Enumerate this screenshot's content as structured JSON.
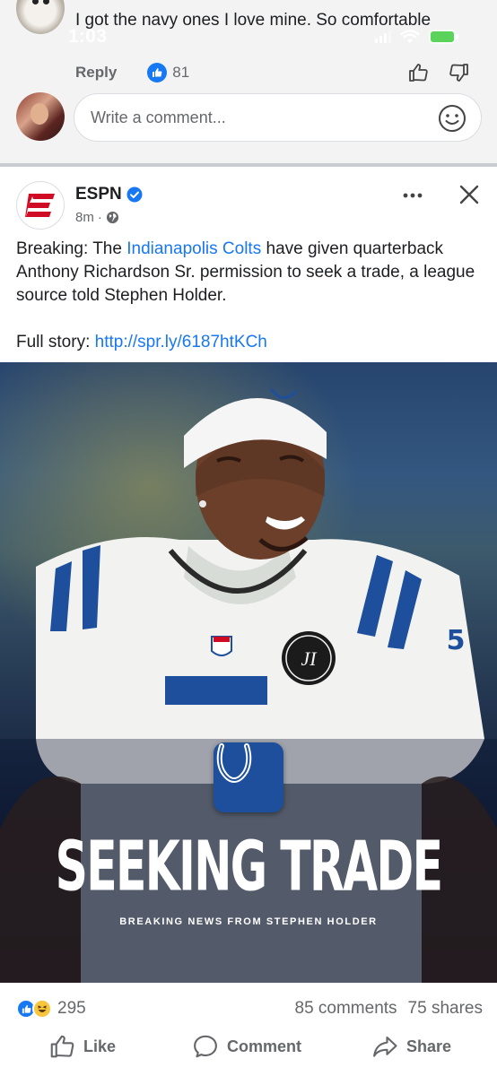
{
  "top_comment": {
    "text": "I got the navy ones I love mine. So comfortable",
    "reply_label": "Reply",
    "like_count": "81"
  },
  "status_bar": {
    "time": "1:03"
  },
  "composer": {
    "placeholder": "Write a comment..."
  },
  "post": {
    "page_name": "ESPN",
    "timestamp": "8m",
    "body_before_link": "Breaking: The ",
    "body_link": "Indianapolis Colts",
    "body_after_link": " have given quarterback Anthony Richardson Sr. permission to seek a trade, a league source told Stephen Holder.",
    "full_story_label": "Full story: ",
    "full_story_url": "http://spr.ly/6187htKCh",
    "image": {
      "headline": "SEEKING TRADE",
      "subline": "BREAKING NEWS FROM STEPHEN HOLDER",
      "jersey_number": "5",
      "patch_text": "JI"
    },
    "reaction_count": "295",
    "comments": "85 comments",
    "shares": "75 shares",
    "actions": {
      "like": "Like",
      "comment": "Comment",
      "share": "Share"
    }
  },
  "colors": {
    "facebook_blue": "#1877f2",
    "espn_red": "#d00b24",
    "colts_blue": "#1d4f9c",
    "muted_text": "#65676b"
  }
}
